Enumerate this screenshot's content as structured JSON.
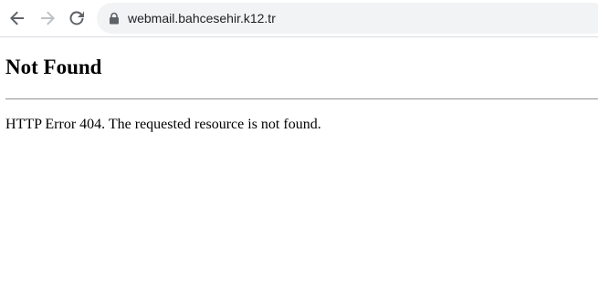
{
  "browser": {
    "url": "webmail.bahcesehir.k12.tr",
    "icons": {
      "back": "back-arrow-icon",
      "forward": "forward-arrow-icon",
      "reload": "reload-icon",
      "lock": "lock-icon"
    },
    "colors": {
      "omnibox_bg": "#f1f3f4",
      "icon_active": "#5f6368",
      "icon_disabled": "#bdc1c6"
    }
  },
  "page": {
    "heading": "Not Found",
    "message": "HTTP Error 404. The requested resource is not found."
  }
}
